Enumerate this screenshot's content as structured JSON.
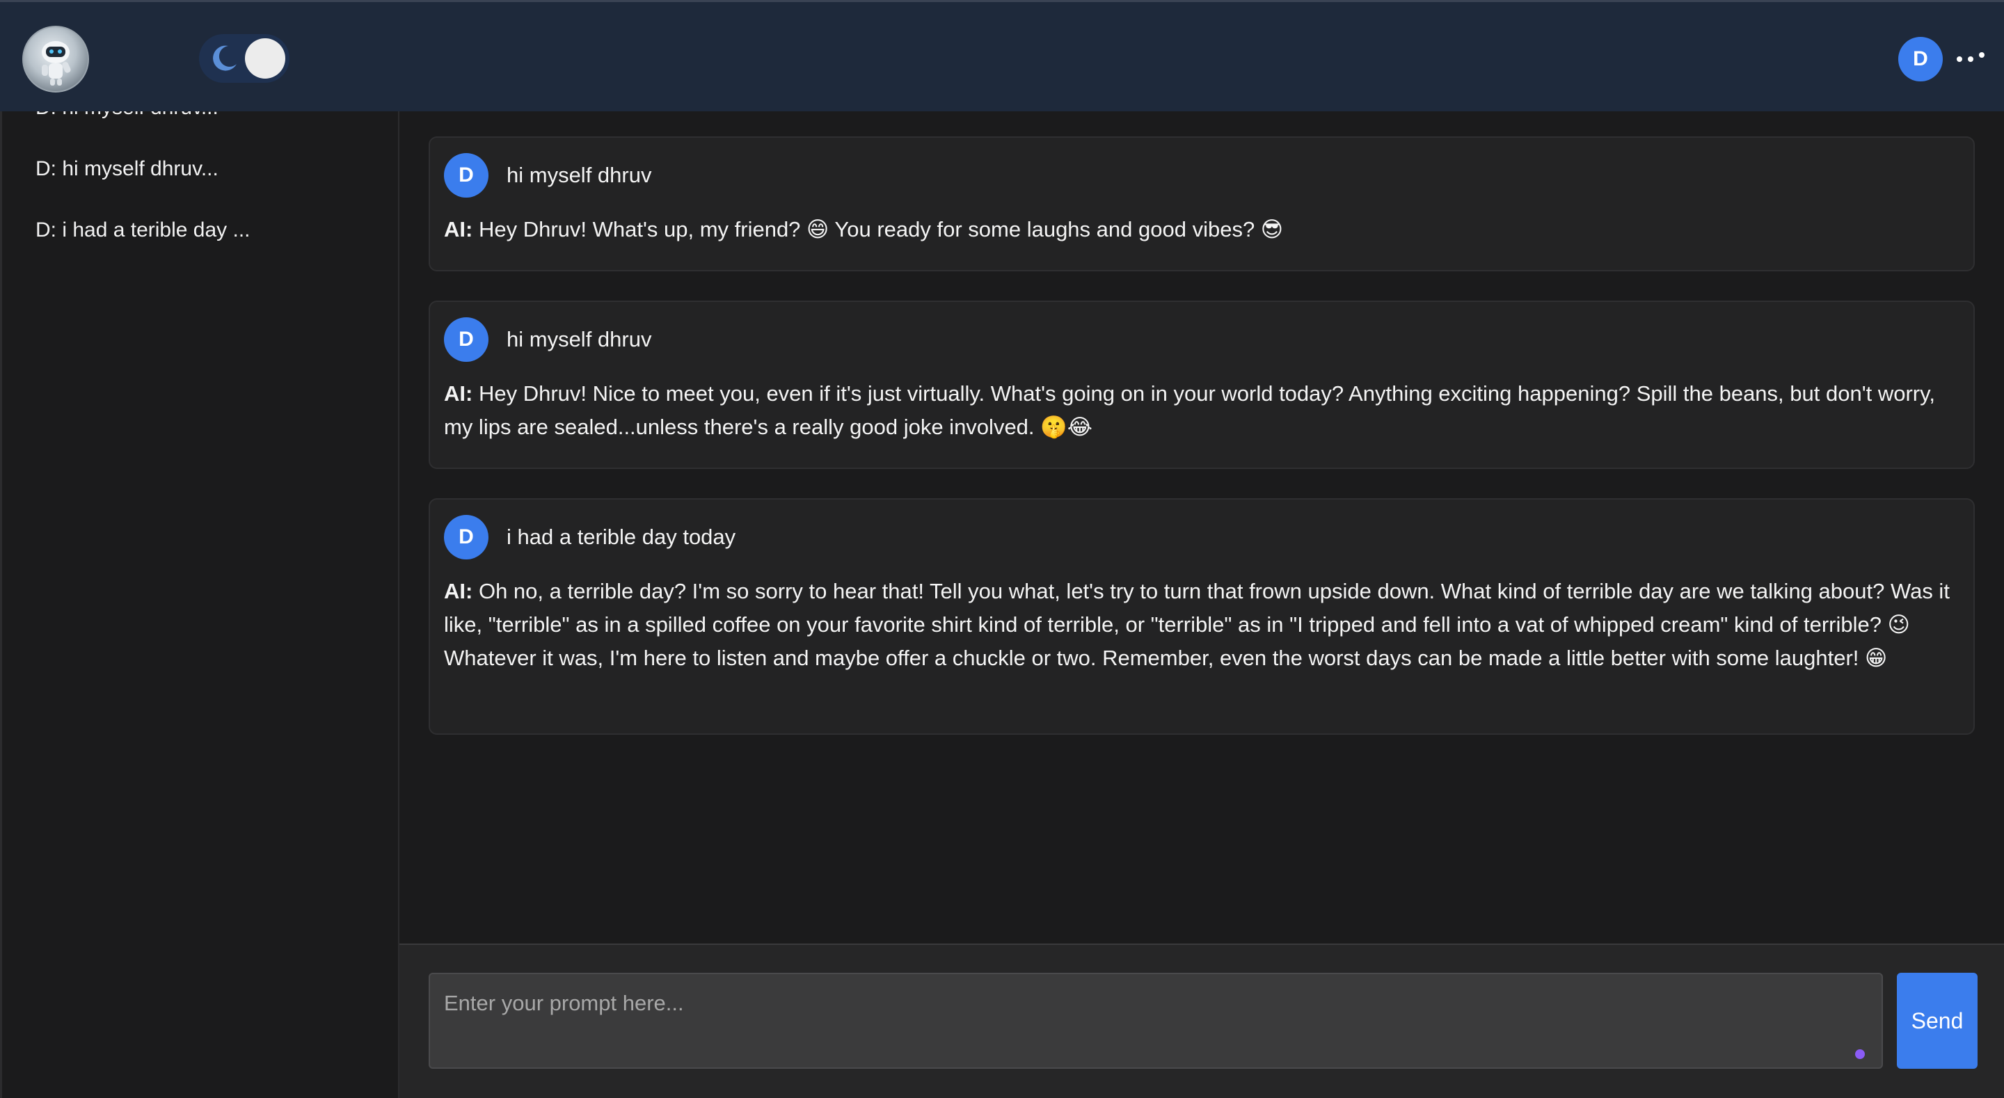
{
  "header": {
    "logo_icon": "robot-logo-icon",
    "theme_toggle_icon": "moon-icon",
    "user_initial": "D",
    "menu_icon": "more-options-icon"
  },
  "sidebar": {
    "items": [
      {
        "label": "D: hi myself dhruv..."
      },
      {
        "label": "D: hi myself dhruv..."
      },
      {
        "label": "D: i had a terible day ..."
      }
    ]
  },
  "conversation": [
    {
      "user_initial": "D",
      "prompt": "hi myself dhruv",
      "ai_label": "AI:",
      "response": "Hey Dhruv! What's up, my friend? 😄 You ready for some laughs and good vibes? 😎"
    },
    {
      "user_initial": "D",
      "prompt": "hi myself dhruv",
      "ai_label": "AI:",
      "response": "Hey Dhruv! Nice to meet you, even if it's just virtually. What's going on in your world today? Anything exciting happening? Spill the beans, but don't worry, my lips are sealed...unless there's a really good joke involved. 🤫😂"
    },
    {
      "user_initial": "D",
      "prompt": "i had a terible day today",
      "ai_label": "AI:",
      "response": "Oh no, a terrible day? I'm so sorry to hear that! Tell you what, let's try to turn that frown upside down. What kind of terrible day are we talking about? Was it like, \"terrible\" as in a spilled coffee on your favorite shirt kind of terrible, or \"terrible\" as in \"I tripped and fell into a vat of whipped cream\" kind of terrible? 😉 Whatever it was, I'm here to listen and maybe offer a chuckle or two. Remember, even the worst days can be made a little better with some laughter! 😁"
    }
  ],
  "composer": {
    "placeholder": "Enter your prompt here...",
    "value": "",
    "send_label": "Send"
  },
  "colors": {
    "header_bg": "#1e293b",
    "accent": "#3b7ded",
    "page_bg": "#1b1b1c",
    "card_bg": "#232324",
    "input_bg": "#3b3b3c"
  }
}
